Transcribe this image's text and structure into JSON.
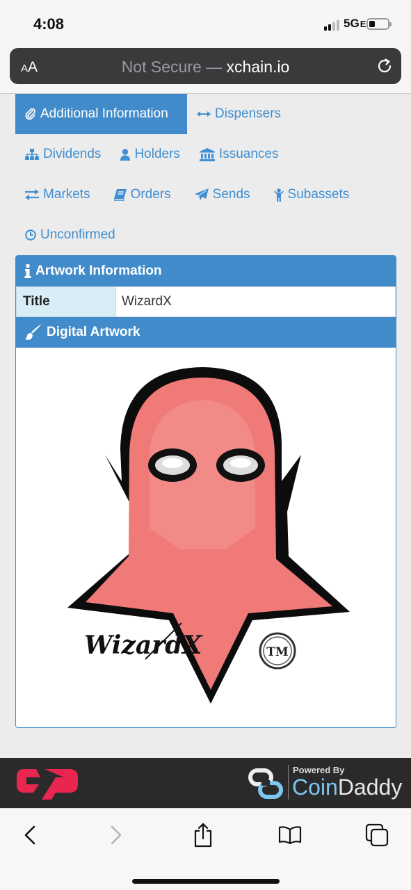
{
  "status_bar": {
    "time": "4:08",
    "network": "5G",
    "network_suffix": "E"
  },
  "address_bar": {
    "text_size_label": "AA",
    "security_label": "Not Secure",
    "separator": " — ",
    "domain": "xchain.io"
  },
  "tabs": [
    {
      "label": "Additional Information",
      "icon": "paperclip-icon",
      "active": true
    },
    {
      "label": "Dispensers",
      "icon": "arrows-horizontal-icon"
    },
    {
      "label": "Dividends",
      "icon": "sitemap-icon"
    },
    {
      "label": "Holders",
      "icon": "user-icon"
    },
    {
      "label": "Issuances",
      "icon": "bank-icon"
    },
    {
      "label": "Markets",
      "icon": "exchange-icon"
    },
    {
      "label": "Orders",
      "icon": "book-icon"
    },
    {
      "label": "Sends",
      "icon": "paper-plane-icon"
    },
    {
      "label": "Subassets",
      "icon": "child-icon"
    },
    {
      "label": "Unconfirmed",
      "icon": "clock-icon"
    }
  ],
  "artwork_info": {
    "heading": "Artwork Information",
    "rows": [
      {
        "key": "Title",
        "value": "WizardX"
      }
    ]
  },
  "digital_artwork": {
    "heading": "Digital Artwork",
    "signature": "WizardX",
    "trademark": "TM"
  },
  "footer": {
    "powered_by": "Powered By",
    "brand_part1": "Coin",
    "brand_part2": "Daddy"
  },
  "colors": {
    "accent": "#428bca",
    "link": "#3f8fd2",
    "label_bg": "#d9edf7",
    "footer_bg": "#2a2a2a",
    "counterparty_red": "#e8264f",
    "ghost_red": "#f07a78"
  }
}
